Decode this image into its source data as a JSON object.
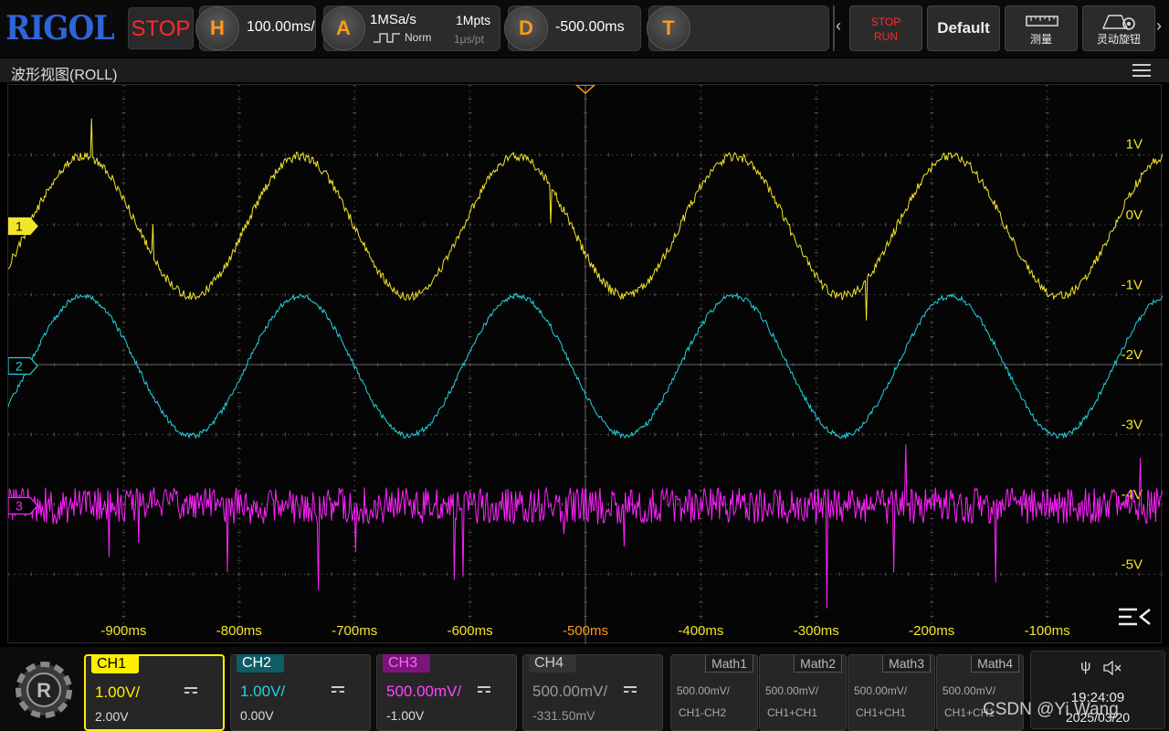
{
  "topbar": {
    "brand": "RIGOL",
    "run_state": "STOP",
    "horizontal": {
      "key": "H",
      "timebase": "100.00ms/"
    },
    "acquire": {
      "key": "A",
      "sample_rate": "1MSa/s",
      "depth": "1Mpts",
      "mode": "Norm",
      "resolution": "1μs/pt"
    },
    "delay": {
      "key": "D",
      "offset": "-500.00ms"
    },
    "trigger": {
      "key": "T"
    },
    "buttons": [
      {
        "top": "STOP",
        "bottom": "RUN"
      },
      {
        "label": "Default"
      },
      {
        "label": "测量"
      },
      {
        "label": "灵动旋钮"
      }
    ]
  },
  "window": {
    "title": "波形视图(ROLL)"
  },
  "channel_markers": [
    "1",
    "2",
    "3"
  ],
  "chart_data": {
    "type": "line",
    "x_ticks": [
      "-900ms",
      "-800ms",
      "-700ms",
      "-600ms",
      "-500ms",
      "-400ms",
      "-300ms",
      "-200ms",
      "-100ms"
    ],
    "y_ticks": [
      "1V",
      "0V",
      "-1V",
      "-2V",
      "-3V",
      "-4V",
      "-5V"
    ],
    "xlim": [
      -1000,
      0
    ],
    "xunit": "ms",
    "grid": true,
    "series": [
      {
        "name": "1",
        "color": "#f2e52a",
        "shape": "sine",
        "period_ms": 188,
        "amplitude_div": 1.0,
        "offset_div": 0.0,
        "noise": "medium-with-spikes"
      },
      {
        "name": "2",
        "color": "#22d3e0",
        "shape": "sine",
        "period_ms": 188,
        "amplitude_div": 1.0,
        "offset_div": -2.0,
        "noise": "light"
      },
      {
        "name": "3",
        "color": "#ff22ff",
        "shape": "noise",
        "offset_div": -4.0,
        "noise": "heavy-with-spikes"
      }
    ]
  },
  "channels": [
    {
      "name": "CH1",
      "scale": "1.00V/",
      "offset": "2.00V",
      "color": "#ffee00",
      "active": true
    },
    {
      "name": "CH2",
      "scale": "1.00V/",
      "offset": "0.00V",
      "color": "#22d3e0",
      "active": false
    },
    {
      "name": "CH3",
      "scale": "500.00mV/",
      "offset": "-1.00V",
      "color": "#ff22ff",
      "active": false
    },
    {
      "name": "CH4",
      "scale": "500.00mV/",
      "offset": "-331.50mV",
      "color": "#888888",
      "active": false
    }
  ],
  "math": [
    {
      "name": "Math1",
      "scale": "500.00mV/",
      "expr": "CH1-CH2"
    },
    {
      "name": "Math2",
      "scale": "500.00mV/",
      "expr": "CH1+CH1"
    },
    {
      "name": "Math3",
      "scale": "500.00mV/",
      "expr": "CH1+CH1"
    },
    {
      "name": "Math4",
      "scale": "500.00mV/",
      "expr": "CH1+CH1"
    }
  ],
  "status": {
    "time": "19:24:09",
    "date": "2025/03/20"
  },
  "watermark": "CSDN @Yi Wang"
}
